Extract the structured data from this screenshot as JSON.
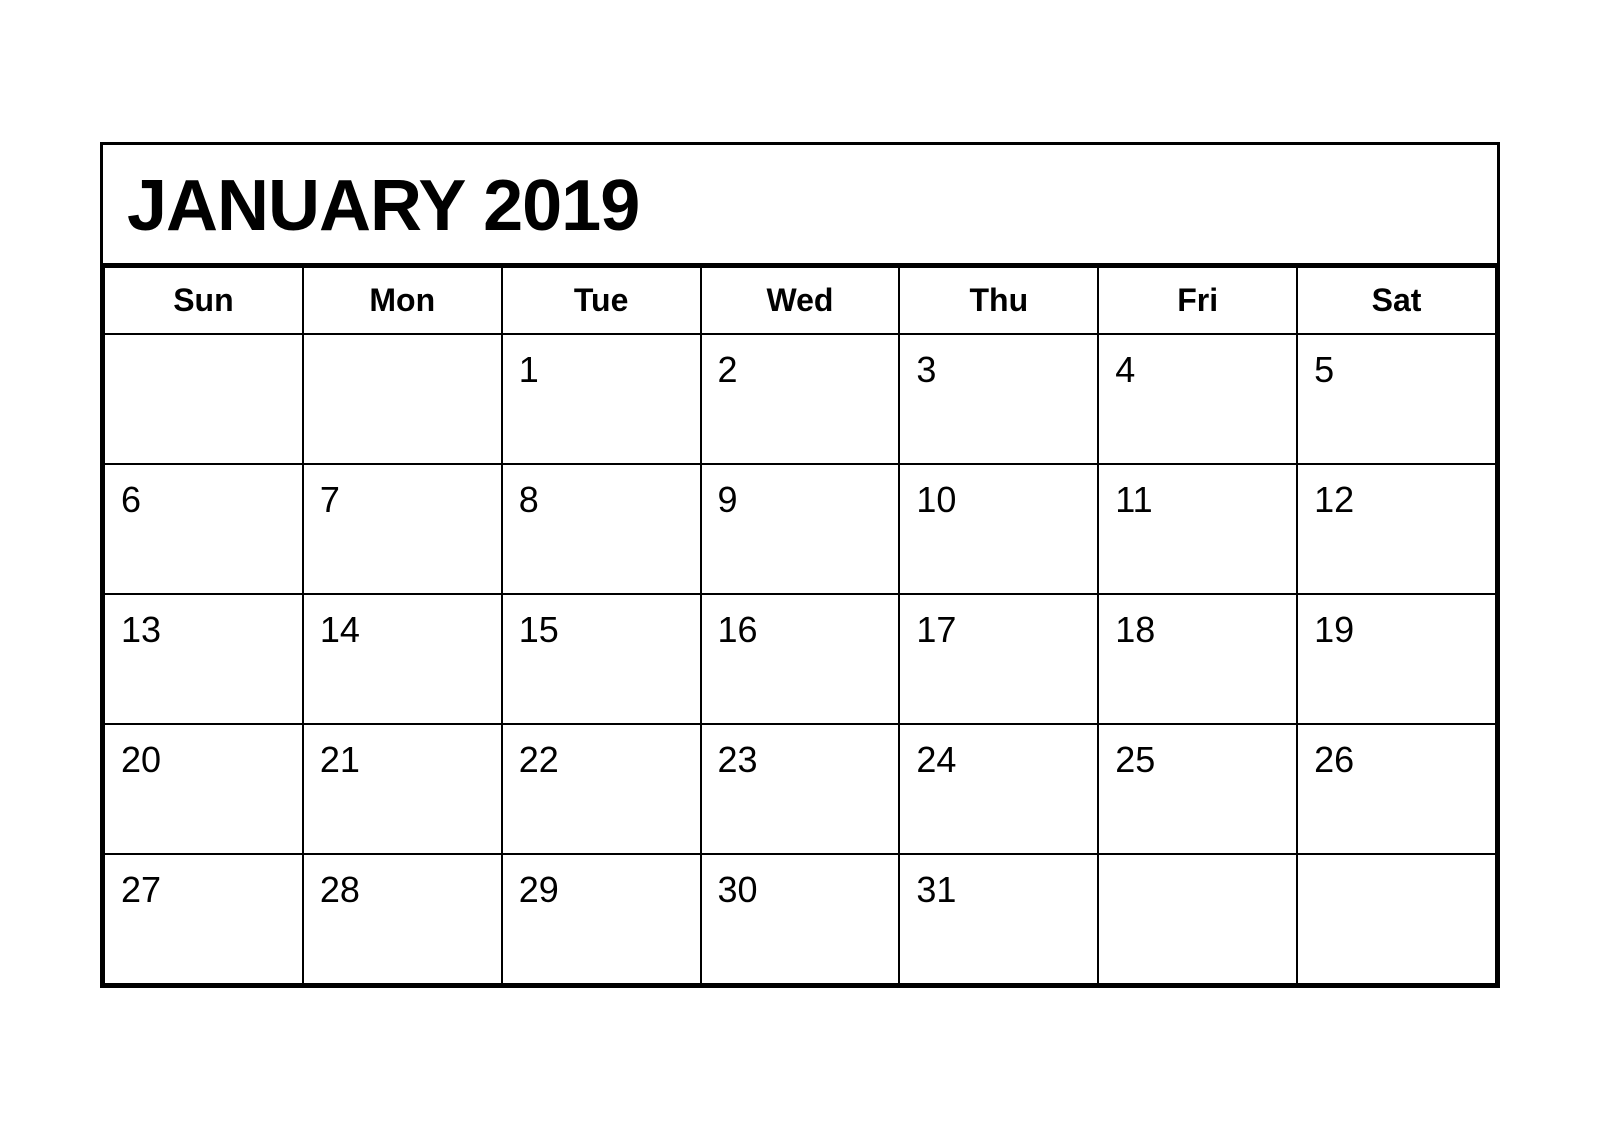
{
  "calendar": {
    "title": "JANUARY 2019",
    "days_of_week": [
      "Sun",
      "Mon",
      "Tue",
      "Wed",
      "Thu",
      "Fri",
      "Sat"
    ],
    "weeks": [
      [
        "",
        "",
        "1",
        "2",
        "3",
        "4",
        "5"
      ],
      [
        "6",
        "7",
        "8",
        "9",
        "10",
        "11",
        "12"
      ],
      [
        "13",
        "14",
        "15",
        "16",
        "17",
        "18",
        "19"
      ],
      [
        "20",
        "21",
        "22",
        "23",
        "24",
        "25",
        "26"
      ],
      [
        "27",
        "28",
        "29",
        "30",
        "31",
        "",
        ""
      ]
    ]
  }
}
